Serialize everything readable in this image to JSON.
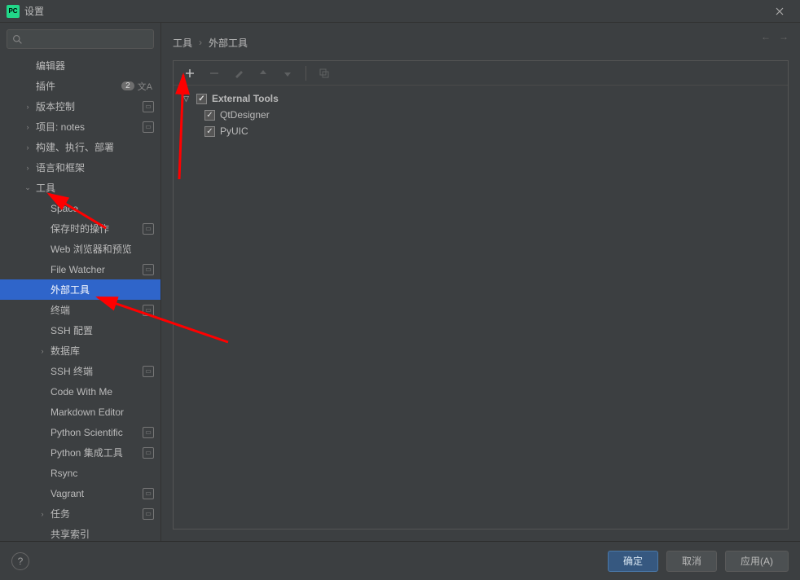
{
  "window": {
    "title": "设置"
  },
  "sidebar": {
    "search_placeholder": "",
    "items": [
      {
        "label": "编辑器",
        "depth": 1,
        "expandable": false,
        "hasChevron": false
      },
      {
        "label": "插件",
        "depth": 1,
        "badge": "2",
        "lang": true
      },
      {
        "label": "版本控制",
        "depth": 1,
        "expandable": true,
        "proj": true
      },
      {
        "label": "项目: notes",
        "depth": 1,
        "expandable": true,
        "proj": true
      },
      {
        "label": "构建、执行、部署",
        "depth": 1,
        "expandable": true
      },
      {
        "label": "语言和框架",
        "depth": 1,
        "expandable": true
      },
      {
        "label": "工具",
        "depth": 1,
        "expandable": true,
        "expanded": true
      },
      {
        "label": "Space",
        "depth": 2
      },
      {
        "label": "保存时的操作",
        "depth": 2,
        "proj": true
      },
      {
        "label": "Web 浏览器和预览",
        "depth": 2
      },
      {
        "label": "File Watcher",
        "depth": 2,
        "proj": true
      },
      {
        "label": "外部工具",
        "depth": 2,
        "selected": true
      },
      {
        "label": "终端",
        "depth": 2,
        "proj": true
      },
      {
        "label": "SSH 配置",
        "depth": 2
      },
      {
        "label": "数据库",
        "depth": 2,
        "expandable": true
      },
      {
        "label": "SSH 终端",
        "depth": 2,
        "proj": true
      },
      {
        "label": "Code With Me",
        "depth": 2
      },
      {
        "label": "Markdown Editor",
        "depth": 2
      },
      {
        "label": "Python Scientific",
        "depth": 2,
        "proj": true
      },
      {
        "label": "Python 集成工具",
        "depth": 2,
        "proj": true
      },
      {
        "label": "Rsync",
        "depth": 2
      },
      {
        "label": "Vagrant",
        "depth": 2,
        "proj": true
      },
      {
        "label": "任务",
        "depth": 2,
        "expandable": true,
        "proj": true
      },
      {
        "label": "共享索引",
        "depth": 2
      }
    ]
  },
  "breadcrumb": {
    "root": "工具",
    "current": "外部工具"
  },
  "tools": {
    "group": "External Tools",
    "items": [
      {
        "label": "QtDesigner",
        "checked": true
      },
      {
        "label": "PyUIC",
        "checked": true
      }
    ]
  },
  "buttons": {
    "ok": "确定",
    "cancel": "取消",
    "apply": "应用(A)"
  }
}
